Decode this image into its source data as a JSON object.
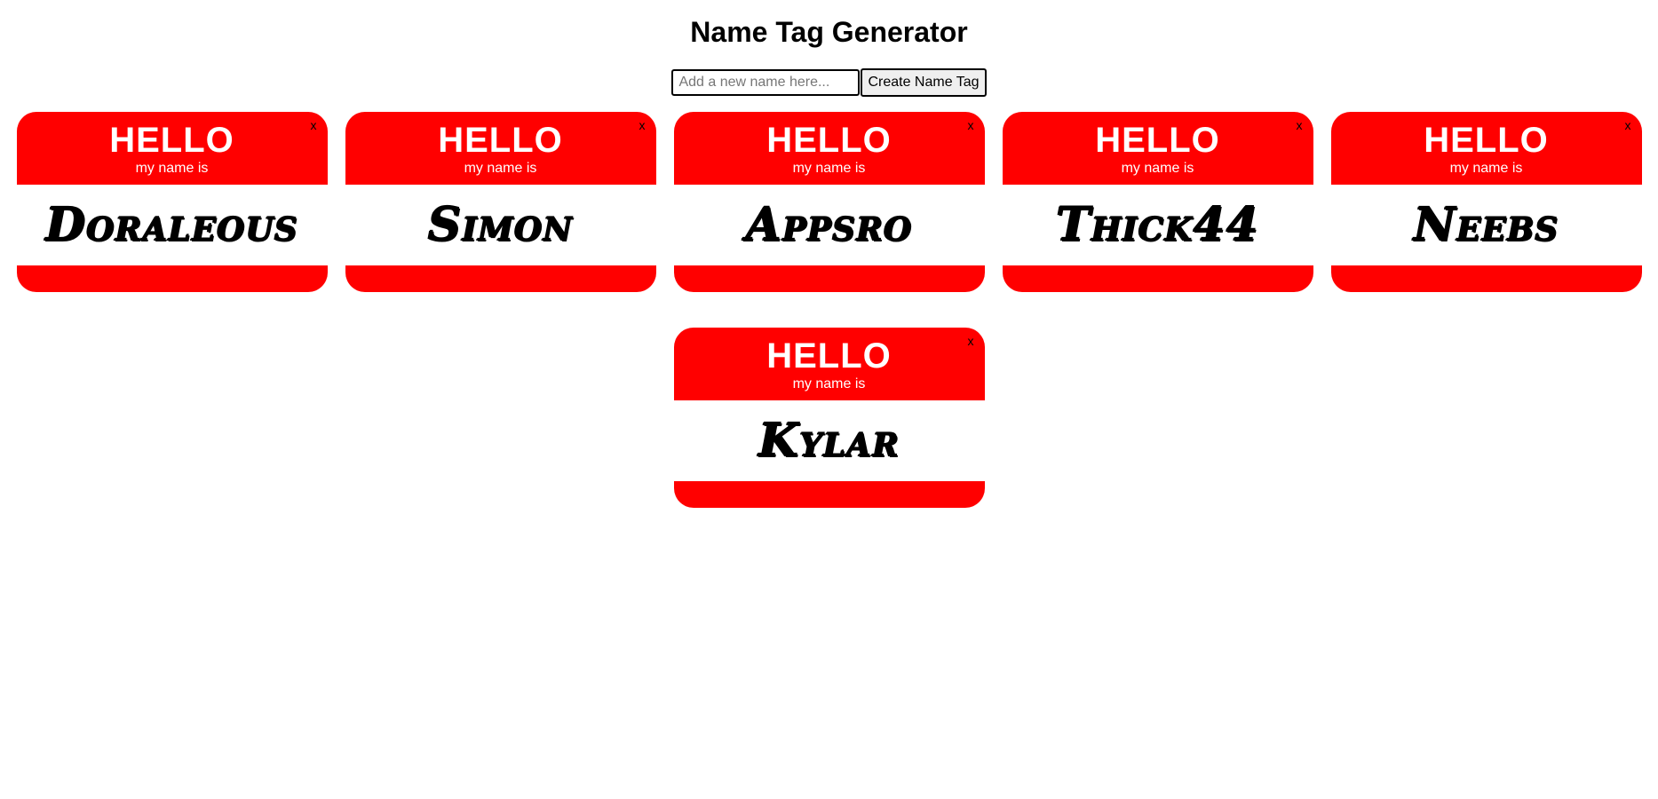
{
  "page": {
    "title": "Name Tag Generator"
  },
  "form": {
    "input_placeholder": "Add a new name here...",
    "input_value": "",
    "create_label": "Create Name Tag"
  },
  "tag_template": {
    "hello": "HELLO",
    "subtitle": "my name is",
    "remove_label": "x"
  },
  "colors": {
    "tag_red": "#ff0000",
    "tag_text": "#ffffff",
    "name_text": "#000000"
  },
  "tags": [
    {
      "name": "Doraleous"
    },
    {
      "name": "Simon"
    },
    {
      "name": "Appsro"
    },
    {
      "name": "Thick44"
    },
    {
      "name": "Neebs"
    },
    {
      "name": "Kylar"
    }
  ]
}
